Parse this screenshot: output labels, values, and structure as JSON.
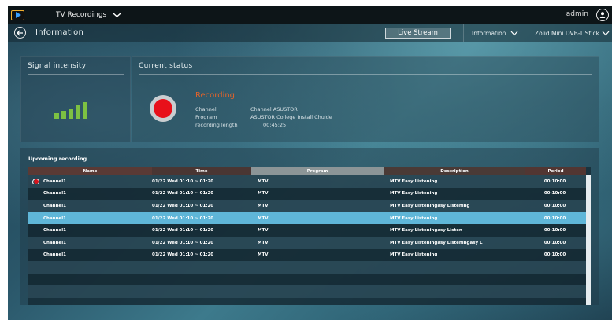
{
  "topbar": {
    "app_name": "TV Recordings",
    "user": "admin"
  },
  "nav": {
    "title": "Information",
    "live_button": "Live Stream",
    "dropdown_info": "Information",
    "dropdown_device": "Zolid Mini DVB-T Stick"
  },
  "signal": {
    "title": "Signal intensity",
    "level": 5,
    "max_level": 5
  },
  "current": {
    "title": "Current status",
    "state": "Recording",
    "channel_label": "Channel",
    "channel_value": "Channel ASUSTOR",
    "program_label": "Program",
    "program_value": "ASUSTOR College Install Chuide",
    "length_label": "recording length",
    "length_value": "00:45:25"
  },
  "upcoming": {
    "title": "Upcoming recording",
    "columns": [
      "Name",
      "Time",
      "Program",
      "Description",
      "Period"
    ],
    "rows": [
      {
        "name": "Channel1",
        "time": "01/22 Wed   01:10 ~ 01:20",
        "program": "MTV",
        "description": "MTV Easy Listening",
        "period": "00:10:00",
        "recording": true
      },
      {
        "name": "Channel1",
        "time": "01/22 Wed   01:10 ~ 01:20",
        "program": "MTV",
        "description": "MTV Easy Listening",
        "period": "00:10:00"
      },
      {
        "name": "Channel1",
        "time": "01/22 Wed   01:10 ~ 01:20",
        "program": "MTV",
        "description": "MTV Easy Listeningasy Listening",
        "period": "00:10:00"
      },
      {
        "name": "Channel1",
        "time": "01/22 Wed   01:10 ~ 01:20",
        "program": "MTV",
        "description": "MTV Easy Listening",
        "period": "00:10:00",
        "selected": true
      },
      {
        "name": "Channel1",
        "time": "01/22 Wed   01:10 ~ 01:20",
        "program": "MTV",
        "description": "MTV Easy Listeningasy Listen",
        "period": "00:10:00"
      },
      {
        "name": "Channel1",
        "time": "01/22 Wed   01:10 ~ 01:20",
        "program": "MTV",
        "description": "MTV Easy Listeningasy Listeningasy L",
        "period": "00:10:00"
      },
      {
        "name": "Channel1",
        "time": "01/22 Wed   01:10 ~ 01:20",
        "program": "MTV",
        "description": "MTV Easy Listening",
        "period": "00:10:00"
      }
    ],
    "empty_rows": 3
  },
  "colors": {
    "header_name": "#5a3a35",
    "header_time": "#4a3633",
    "header_program": "#8c9597",
    "header_description": "#4a3a36",
    "header_period": "#523632",
    "selected_row": "#5fb6d8",
    "recording": "#e8101a",
    "signal": "#7dc142"
  }
}
